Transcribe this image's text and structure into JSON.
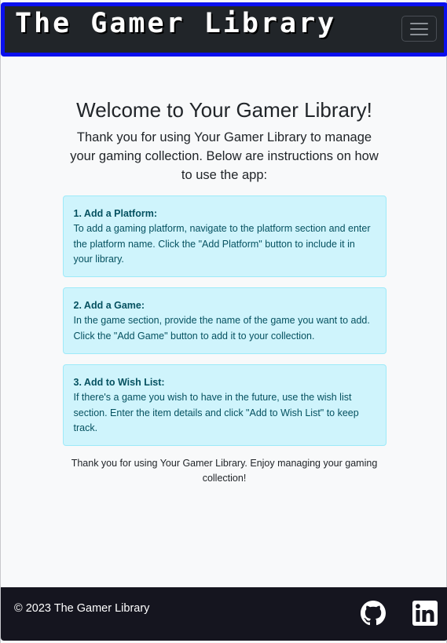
{
  "header": {
    "brand": "The Gamer Library",
    "menu_icon": "hamburger-menu-icon"
  },
  "main": {
    "title": "Welcome to Your Gamer Library!",
    "intro": "Thank you for using Your Gamer Library to manage your gaming collection. Below are instructions on how to use the app:",
    "steps": [
      {
        "title": "1. Add a Platform:",
        "text": "To add a gaming platform, navigate to the platform section and enter the platform name. Click the \"Add Platform\" button to include it in your library."
      },
      {
        "title": "2. Add a Game:",
        "text": "In the game section, provide the name of the game you want to add. Click the \"Add Game\" button to add it to your collection."
      },
      {
        "title": "3. Add to Wish List:",
        "text": "If there's a game you wish to have in the future, use the wish list section. Enter the item details and click \"Add to Wish List\" to keep track."
      }
    ],
    "outro": "Thank you for using Your Gamer Library. Enjoy managing your gaming collection!"
  },
  "footer": {
    "copyright": "© 2023 The Gamer Library",
    "links": [
      {
        "icon": "github-icon"
      },
      {
        "icon": "linkedin-icon"
      }
    ]
  },
  "colors": {
    "navbar_bg": "#212529",
    "navbar_border": "#0a10ee",
    "card_bg": "#cff4fc",
    "card_text": "#055160",
    "footer_bg": "#15151f",
    "page_bg": "#f8f9fa"
  }
}
